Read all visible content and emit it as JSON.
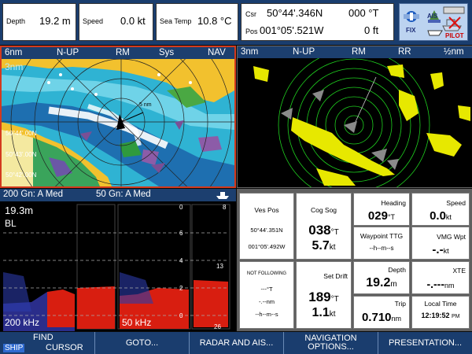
{
  "topbar": {
    "depth_label": "Depth",
    "depth_value": "19.2 m",
    "speed_label": "Speed",
    "speed_value": "0.0 kt",
    "seatemp_label": "Sea Temp",
    "seatemp_value": "10.8 °C",
    "csr_label": "Csr",
    "csr_lat": "50°44'.346N",
    "csr_bearing": "000 °T",
    "pos_label": "Pos",
    "pos_lon": "001°05'.521W",
    "pos_dist": "0 ft",
    "status_icons": {
      "fix": "FIX",
      "ais": "AIS",
      "pilot": "PILOT"
    }
  },
  "chart_pane": {
    "range": "6nm",
    "orientation": "N-UP",
    "motion": "RM",
    "sys": "Sys",
    "nav": "NAV",
    "overlay_range": "3nm",
    "lat_labels": [
      "50°44'.00N",
      "50°43'.00N",
      "50°42'.00N"
    ],
    "ring_label": "5 nm"
  },
  "radar_pane": {
    "range": "3nm",
    "orientation": "N-UP",
    "motion": "RM",
    "rr": "RR",
    "ring_interval": "½nm"
  },
  "sonar_pane": {
    "header_left": "200 Gn: A Med",
    "header_right": "50 Gn: A Med",
    "depth_readout": "19.3m",
    "bl_label": "BL",
    "freq_left": "200 kHz",
    "freq_right": "50 kHz",
    "scale": [
      "0",
      "8",
      "6",
      "4",
      "13",
      "2",
      "0",
      "26"
    ]
  },
  "data_pane": {
    "ves_pos": {
      "label": "Ves Pos",
      "lat": "50°44'.351N",
      "lon": "001°05'.492W"
    },
    "cog_sog": {
      "label": "Cog Sog",
      "cog": "038",
      "cog_unit": "°T",
      "sog": "5.7",
      "sog_unit": "kt"
    },
    "heading": {
      "label": "Heading",
      "value": "029",
      "unit": "°T"
    },
    "speed": {
      "label": "Speed",
      "value": "0.0",
      "unit": "kt"
    },
    "waypoint_ttg": {
      "label": "Waypoint TTG",
      "value": "--h--m--s"
    },
    "vmg_wpt": {
      "label": "VMG Wpt",
      "value": "-.-",
      "unit": "kt"
    },
    "not_following": {
      "label": "NOT FOLLOWING",
      "v1": "---°T",
      "v2": "-.--nm",
      "v3": "--h--m--s"
    },
    "set_drift": {
      "label": "Set Drift",
      "set": "189",
      "set_unit": "°T",
      "drift": "1.1",
      "drift_unit": "kt"
    },
    "depth": {
      "label": "Depth",
      "value": "19.2",
      "unit": "m"
    },
    "xte": {
      "label": "XTE",
      "value": "-.---",
      "unit": "nm"
    },
    "trip": {
      "label": "Trip",
      "value": "0.710",
      "unit": "nm"
    },
    "local_time": {
      "label": "Local Time",
      "value": "12:19:52",
      "unit": "PM"
    }
  },
  "softkeys": {
    "ship": "SHIP",
    "find_top": "FIND",
    "cursor": "CURSOR",
    "goto": "GOTO...",
    "radar_ais": "RADAR AND AIS...",
    "nav_top": "NAVIGATION",
    "nav_bottom": "OPTIONS...",
    "presentation": "PRESENTATION..."
  },
  "colors": {
    "frame": "#1a3d6e",
    "sea_deep": "#33b6d2",
    "land": "#f2c12e",
    "radar_echo": "#e7e800",
    "radar_rings": "#1fd11f",
    "sonar_bottom": "#d81e10"
  }
}
